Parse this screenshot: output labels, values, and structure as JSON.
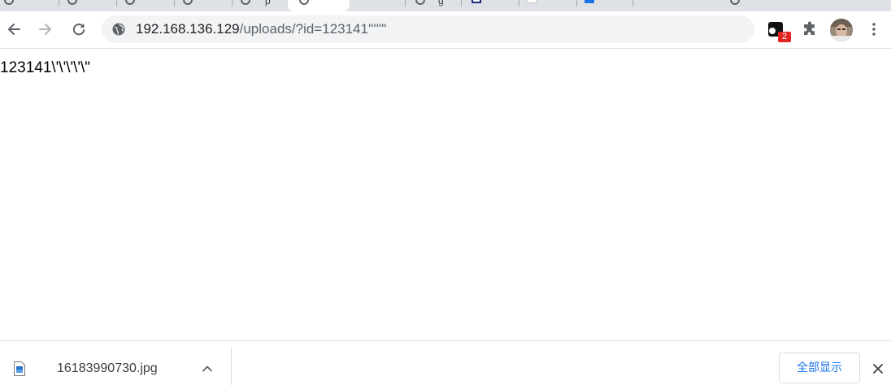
{
  "browser": {
    "tabs": [
      {
        "kind": "ring",
        "title_fragment": ""
      },
      {
        "kind": "ring",
        "title_fragment": ""
      },
      {
        "kind": "ring",
        "title_fragment": ""
      },
      {
        "kind": "ring",
        "title_fragment": ""
      },
      {
        "kind": "ring",
        "title_fragment": "p"
      },
      {
        "kind": "ring",
        "title_fragment": "",
        "active": true
      },
      {
        "kind": "ring",
        "title_fragment": "g"
      },
      {
        "kind": "square-navy",
        "title_fragment": ""
      },
      {
        "kind": "square-white",
        "title_fragment": ""
      },
      {
        "kind": "square-blue",
        "title_fragment": ""
      }
    ],
    "omnibox": {
      "url_host": "192.168.136.129",
      "url_rest": "/uploads/?id=123141'''''\"",
      "site_icon": "info-globe-icon"
    },
    "extension": {
      "icon": "extension-app-icon",
      "badge": "2"
    },
    "icons": {
      "back": "back-arrow-icon",
      "forward": "forward-arrow-icon",
      "reload": "reload-icon",
      "puzzle": "extensions-puzzle-icon",
      "avatar": "profile-avatar",
      "menu": "kebab-menu-icon"
    },
    "colors": {
      "tabstrip": "#dee1e6",
      "omnibox": "#f1f3f4",
      "badge": "#e52222",
      "link_blue": "#1a73e8"
    }
  },
  "page": {
    "body_text": "123141\\'\\'\\'\\'\\\""
  },
  "downloads": {
    "file_name": "16183990730.jpg",
    "show_all_label": "全部显示"
  }
}
